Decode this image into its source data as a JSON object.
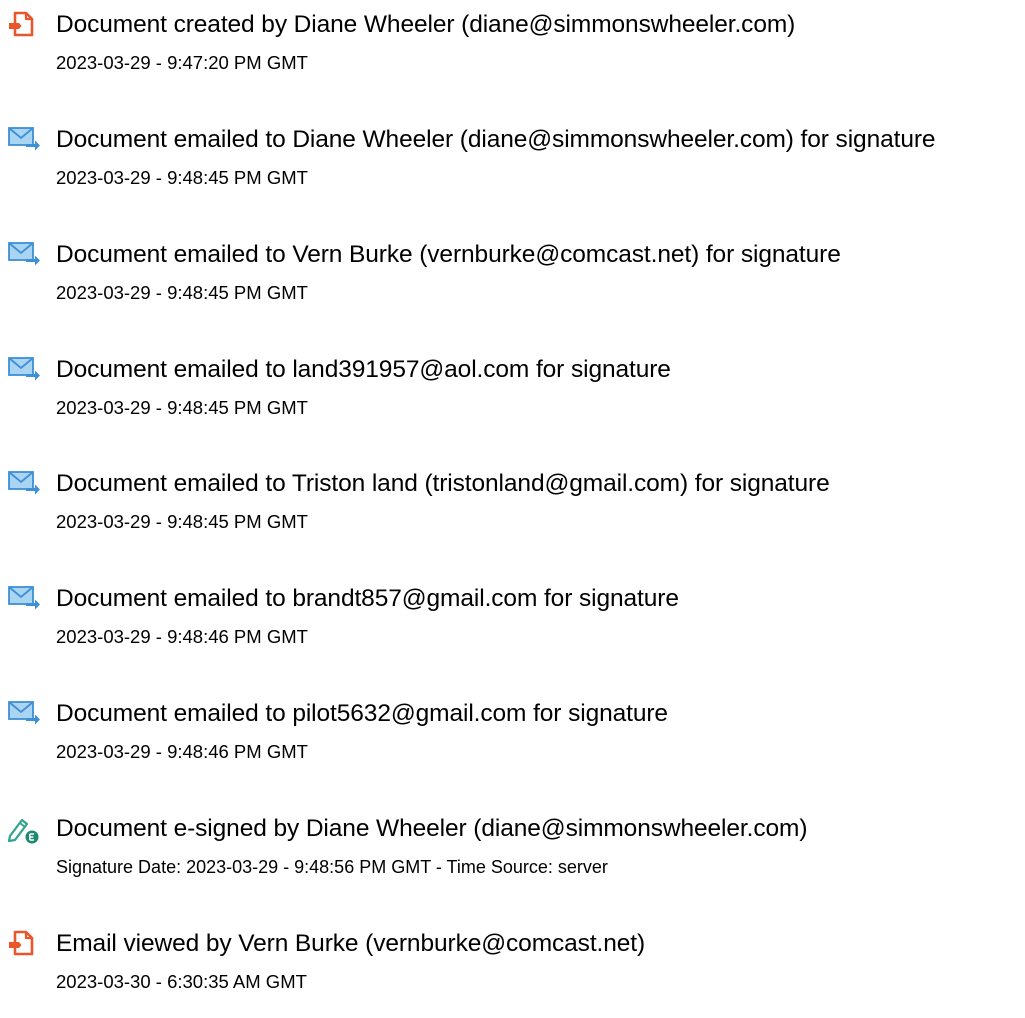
{
  "audit_log": {
    "entries": [
      {
        "icon": "document-created-icon",
        "text": "Document created by Diane Wheeler (diane@simmonswheeler.com)",
        "detail": "2023-03-29 - 9:47:20 PM GMT"
      },
      {
        "icon": "email-sent-icon",
        "text": "Document emailed to Diane Wheeler (diane@simmonswheeler.com) for signature",
        "detail": "2023-03-29 - 9:48:45 PM GMT"
      },
      {
        "icon": "email-sent-icon",
        "text": "Document emailed to Vern Burke (vernburke@comcast.net) for signature",
        "detail": "2023-03-29 - 9:48:45 PM GMT"
      },
      {
        "icon": "email-sent-icon",
        "text": "Document emailed to land391957@aol.com for signature",
        "detail": "2023-03-29 - 9:48:45 PM GMT"
      },
      {
        "icon": "email-sent-icon",
        "text": "Document emailed to Triston land (tristonland@gmail.com) for signature",
        "detail": "2023-03-29 - 9:48:45 PM GMT"
      },
      {
        "icon": "email-sent-icon",
        "text": "Document emailed to brandt857@gmail.com for signature",
        "detail": "2023-03-29 - 9:48:46 PM GMT"
      },
      {
        "icon": "email-sent-icon",
        "text": "Document emailed to pilot5632@gmail.com for signature",
        "detail": "2023-03-29 - 9:48:46 PM GMT"
      },
      {
        "icon": "esign-icon",
        "text": "Document e-signed by Diane Wheeler (diane@simmonswheeler.com)",
        "detail": "Signature Date: 2023-03-29 - 9:48:56 PM GMT - Time Source: server"
      },
      {
        "icon": "document-viewed-icon",
        "text": "Email viewed by Vern Burke (vernburke@comcast.net)",
        "detail": "2023-03-30 - 6:30:35 AM GMT"
      }
    ]
  },
  "colors": {
    "document_icon": "#e8562b",
    "email_icon_light": "#a9d4f2",
    "email_icon_stroke": "#3d8fd6",
    "esign_pen": "#2fa58b",
    "esign_badge": "#1c8a73"
  }
}
